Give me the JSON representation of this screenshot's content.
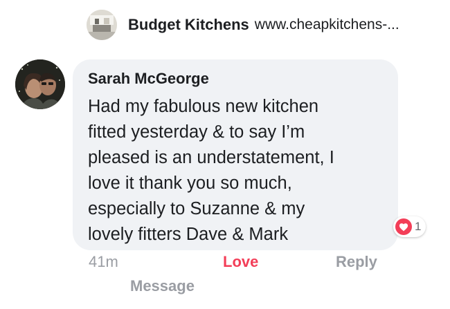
{
  "page_header": {
    "name": "Budget Kitchens",
    "url": "www.cheapkitchens-..."
  },
  "comment": {
    "author": "Sarah McGeorge",
    "text_lines": [
      "Had my fabulous new kitchen",
      "fitted yesterday & to say I’m",
      "pleased is an understatement, I",
      "love it thank you so much,",
      "especially to Suzanne & my",
      "lovely fitters Dave & Mark"
    ],
    "reaction": {
      "icon": "heart-icon",
      "count": "1",
      "color": "#f33e58"
    },
    "timestamp": "41m",
    "actions": {
      "love": "Love",
      "reply": "Reply",
      "message": "Message"
    }
  },
  "colors": {
    "bubble_background": "#f0f2f5",
    "love_active": "#f33e58",
    "secondary_text": "#9a9da3"
  }
}
